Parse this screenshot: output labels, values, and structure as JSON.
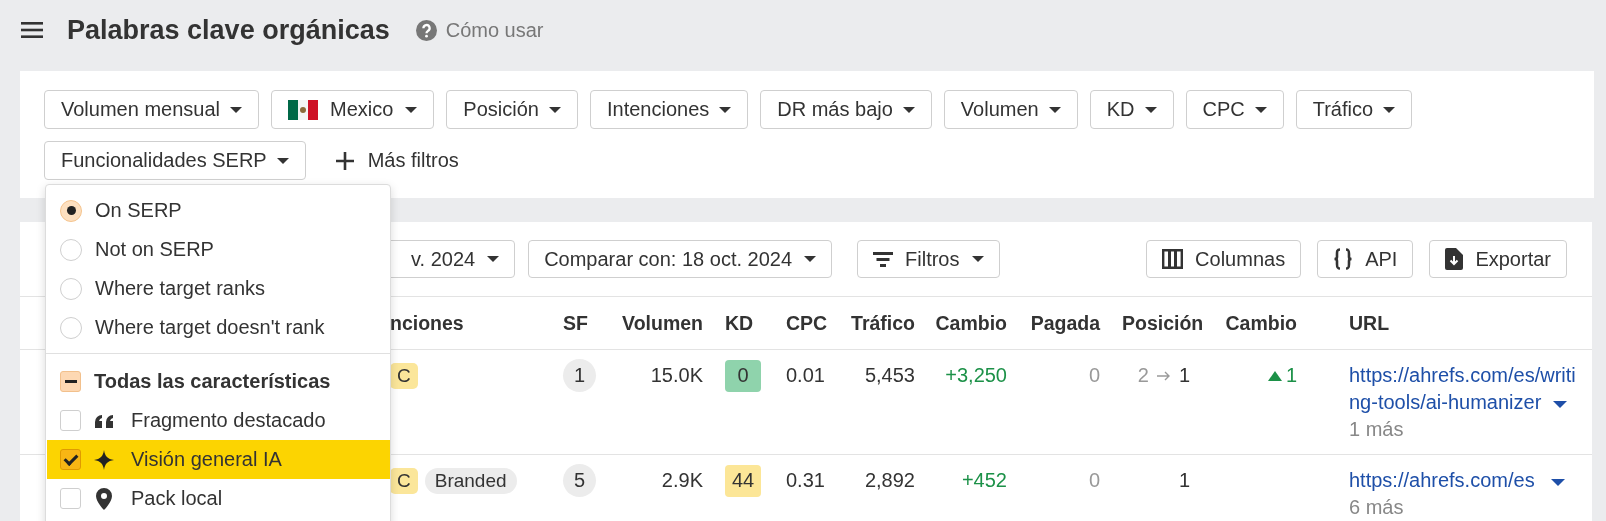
{
  "header": {
    "title": "Palabras clave orgánicas",
    "help_link": "Cómo usar"
  },
  "filters": [
    {
      "label": "Volumen mensual",
      "kind": "plain"
    },
    {
      "label": "Mexico",
      "kind": "country"
    },
    {
      "label": "Posición",
      "kind": "plain"
    },
    {
      "label": "Intenciones",
      "kind": "plain"
    },
    {
      "label": "DR más bajo",
      "kind": "plain"
    },
    {
      "label": "Volumen",
      "kind": "plain"
    },
    {
      "label": "KD",
      "kind": "plain"
    },
    {
      "label": "CPC",
      "kind": "plain"
    },
    {
      "label": "Tráfico",
      "kind": "plain"
    },
    {
      "label": "Funcionalidades SERP",
      "kind": "plain"
    }
  ],
  "more_filters": "Más filtros",
  "serp_menu": {
    "options": [
      {
        "label": "On SERP",
        "selected": true
      },
      {
        "label": "Not on SERP",
        "selected": false
      },
      {
        "label": "Where target ranks",
        "selected": false
      },
      {
        "label": "Where target doesn't rank",
        "selected": false
      }
    ],
    "all": {
      "label": "Todas las características",
      "indeterminate": true
    },
    "features": [
      {
        "label": "Fragmento destacado",
        "kind": "quote",
        "checked": false
      },
      {
        "label": "Visión general IA",
        "kind": "sparkle",
        "checked": true
      },
      {
        "label": "Pack local",
        "kind": "pin",
        "checked": false
      }
    ]
  },
  "toolbar": {
    "date": "v. 2024",
    "compare": "Comparar con: 18 oct. 2024",
    "filters": "Filtros",
    "columns": "Columnas",
    "api": "API",
    "export": "Exportar"
  },
  "table": {
    "columns": [
      "nciones",
      "SF",
      "Volumen",
      "KD",
      "CPC",
      "Tráfico",
      "Cambio",
      "Pagada",
      "Posición",
      "Cambio",
      "URL"
    ],
    "rows": [
      {
        "intents": [
          {
            "label": "C",
            "kind": "intent"
          }
        ],
        "sf": "1",
        "volume": "15.0K",
        "kd": {
          "value": "0",
          "color": "#8fd3ac"
        },
        "cpc": "0.01",
        "traffic": "5,453",
        "traffic_change": "+3,250",
        "paid": "0",
        "position": {
          "from": "2",
          "to": "1"
        },
        "position_change": {
          "up": true,
          "value": "1"
        },
        "url": "https://ahrefs.com/es/writing-tools/ai-humanizer",
        "more": "1 más"
      },
      {
        "intents": [
          {
            "label": "C",
            "kind": "intent"
          },
          {
            "label": "Branded",
            "kind": "tag"
          }
        ],
        "sf": "5",
        "volume": "2.9K",
        "kd": {
          "value": "44",
          "color": "#fce697"
        },
        "cpc": "0.31",
        "traffic": "2,892",
        "traffic_change": "+452",
        "paid": "0",
        "position": {
          "to": "1"
        },
        "url": "https://ahrefs.com/es",
        "more": "6 más"
      }
    ]
  }
}
